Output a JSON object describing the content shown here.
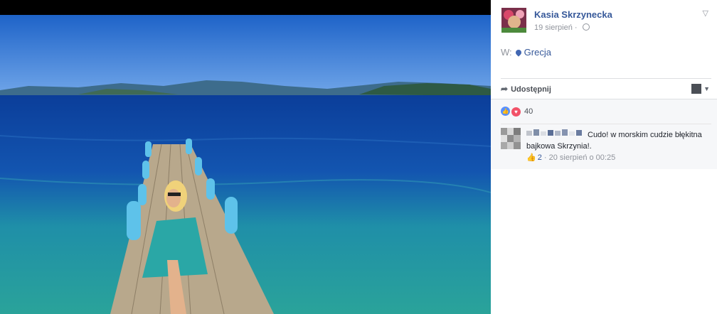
{
  "post": {
    "author": "Kasia Skrzynecka",
    "date": "19 sierpień",
    "separator": "·",
    "location_prefix": "W:",
    "location": "Grecja"
  },
  "actions": {
    "share_label": "Udostępnij"
  },
  "reactions": {
    "count": "40"
  },
  "comment": {
    "text": "Cudo! w morskim cudzie błękitna bajkowa Skrzynia!.",
    "likes": "2",
    "separator": "·",
    "timestamp": "20 sierpień o 00:25"
  },
  "colors": {
    "link": "#365899",
    "like_blue": "#5890ff",
    "love_red": "#f25268",
    "muted": "#90949c",
    "comment_bg": "#f6f7f9"
  },
  "icons": {
    "privacy": "globe-icon",
    "location": "map-pin-icon",
    "share": "share-arrow-icon",
    "menu": "chevron-down-icon",
    "like": "like-reaction-icon",
    "love": "love-reaction-icon",
    "comment_like": "thumbs-up-icon"
  }
}
